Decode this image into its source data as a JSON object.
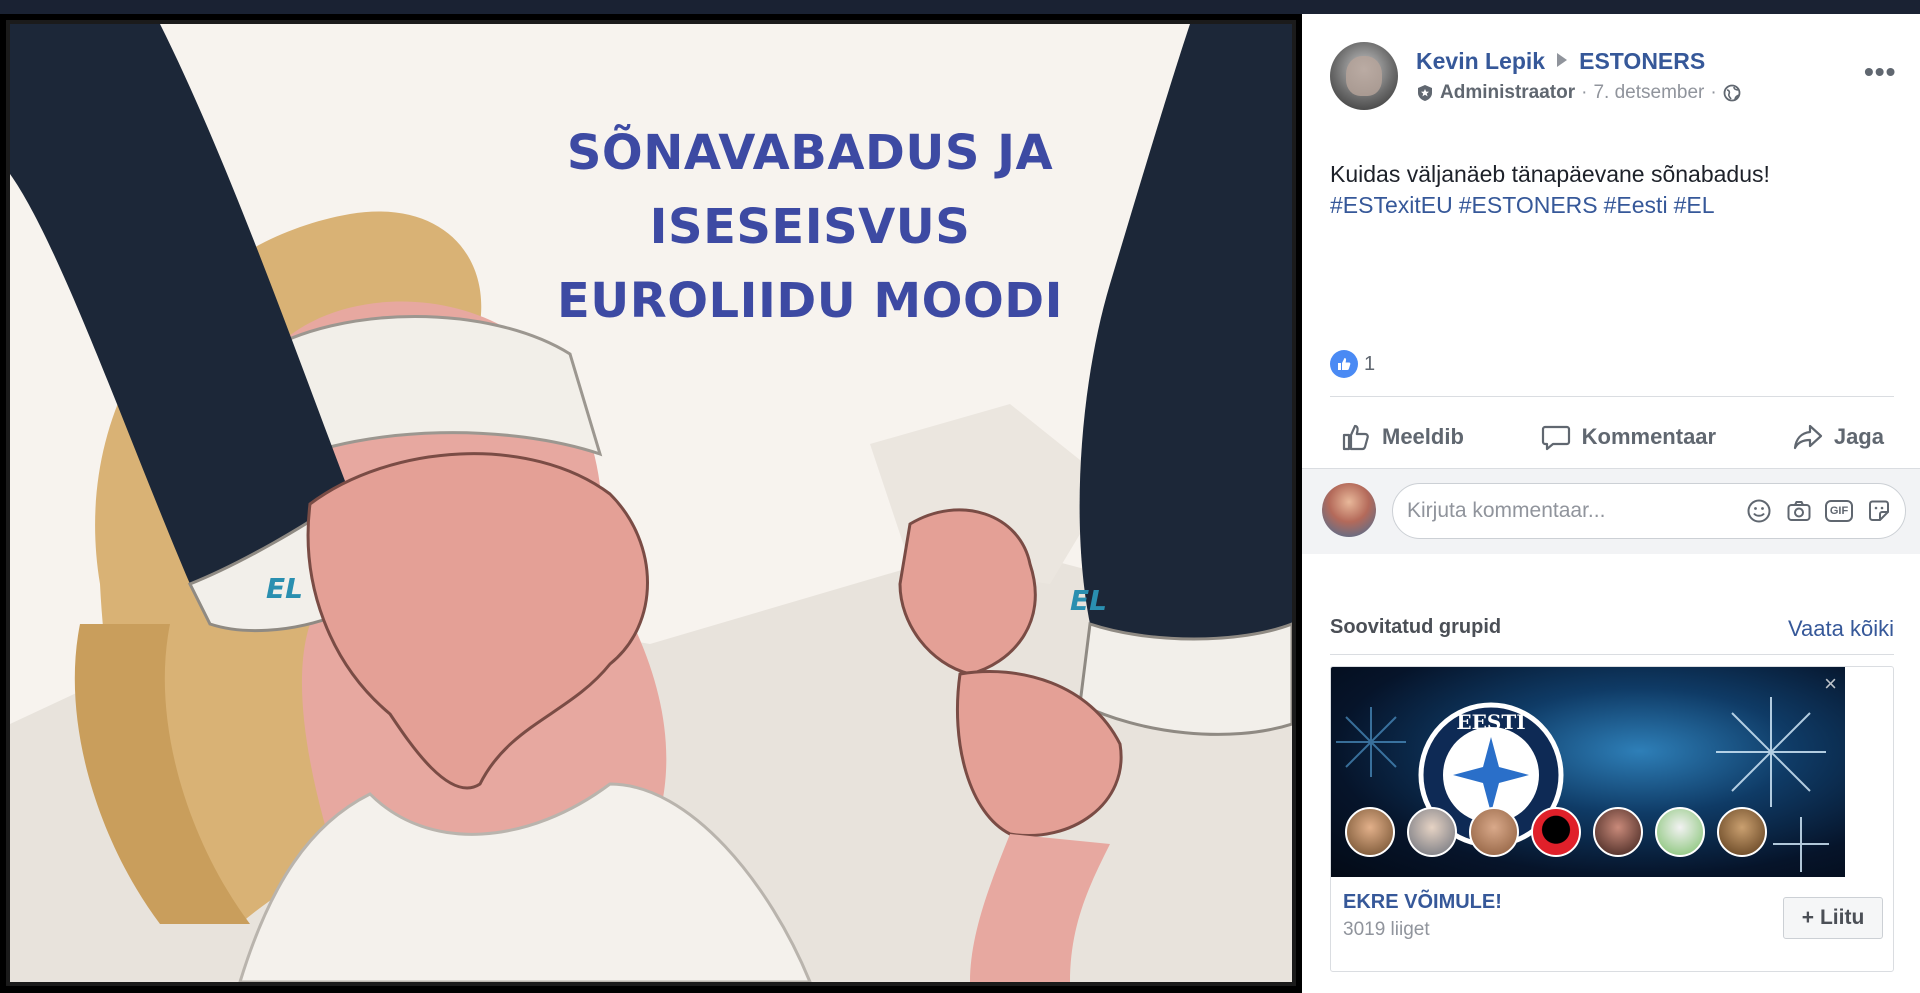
{
  "post": {
    "author": "Kevin Lepik",
    "group": "ESTONERS",
    "role": "Administraator",
    "date": "7. detsember",
    "separator": "·",
    "text": "Kuidas väljanäeb tänapäevane sõnabadus!",
    "hashtags": [
      "#ESTexitEU",
      "#ESTONERS",
      "#Eesti",
      "#EL"
    ],
    "reaction_count": "1",
    "more_label": "•••"
  },
  "image": {
    "title_lines": [
      "SÕNAVABADUS JA",
      "ISESEISVUS",
      "EUROLIIDU MOODI"
    ],
    "cuff_left": "EL",
    "cuff_right": "EL"
  },
  "actions": {
    "like": "Meeldib",
    "comment": "Kommentaar",
    "share": "Jaga"
  },
  "comment_box": {
    "placeholder": "Kirjuta kommentaar..."
  },
  "suggested": {
    "title": "Soovitatud grupid",
    "see_all": "Vaata kõiki",
    "close": "×",
    "group": {
      "name": "EKRE VÕIMULE!",
      "members": "3019 liiget",
      "join_label": "Liitu",
      "join_icon": "+",
      "logo_text": "EESTI"
    }
  },
  "colors": {
    "link": "#365899",
    "like_blue": "#4a8af4",
    "secondary_text": "#90949c",
    "cartoon_title": "#3d4aa3"
  },
  "icons": [
    "admin-badge-icon",
    "globe-icon",
    "thumbs-up-icon",
    "speech-bubble-icon",
    "share-arrow-icon",
    "smiley-icon",
    "camera-icon",
    "gif-icon",
    "sticker-icon",
    "close-icon",
    "plus-icon"
  ]
}
